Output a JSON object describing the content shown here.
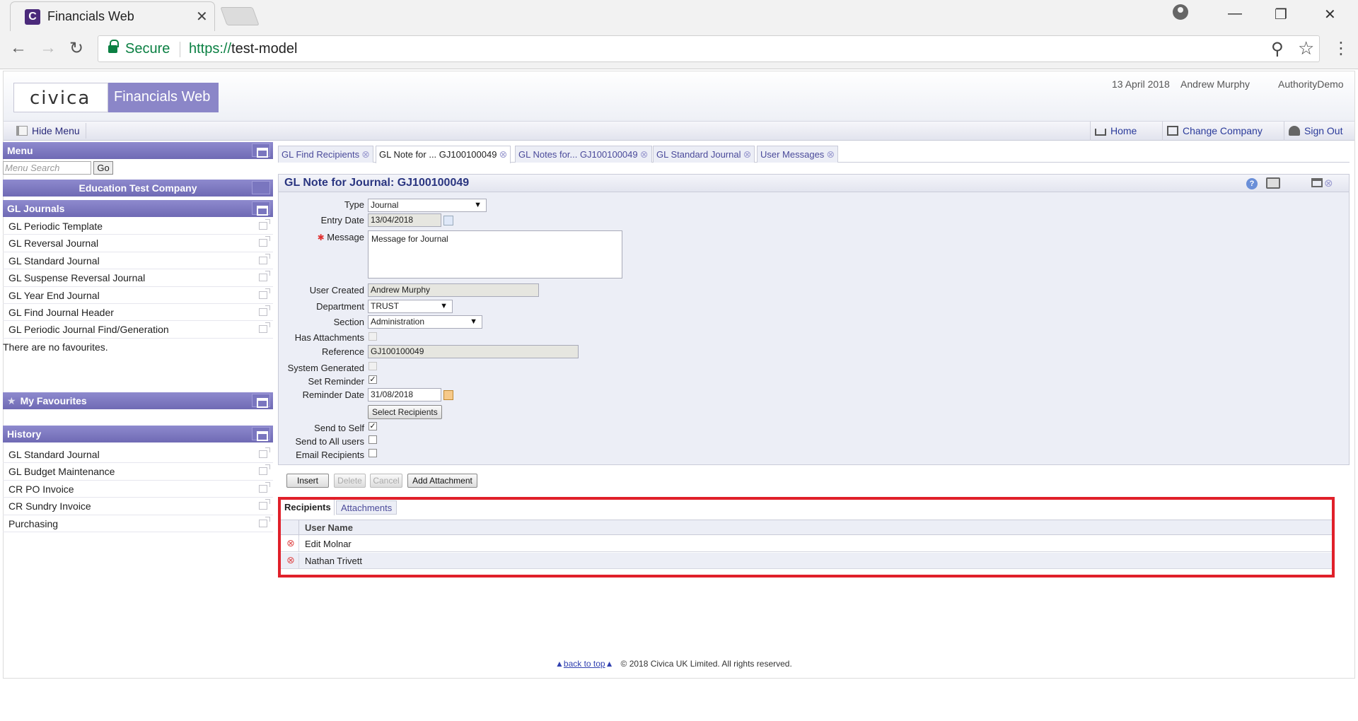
{
  "browser": {
    "tab_title": "Financials Web",
    "secure_label": "Secure",
    "url_scheme": "https://",
    "url_host": "test-model"
  },
  "header": {
    "logo": "civica",
    "product": "Financials Web",
    "date": "13 April 2018",
    "user": "Andrew Murphy",
    "company": "AuthorityDemo"
  },
  "toolbar": {
    "hide_menu": "Hide Menu",
    "home": "Home",
    "change_company": "Change Company",
    "sign_out": "Sign Out"
  },
  "menu": {
    "title": "Menu",
    "search_placeholder": "Menu Search",
    "go": "Go",
    "company": "Education Test Company",
    "section": "GL Journals",
    "items": [
      "GL Periodic Template",
      "GL Reversal Journal",
      "GL Standard Journal",
      "GL Suspense Reversal Journal",
      "GL Year End Journal",
      "GL Find Journal Header",
      "GL Periodic Journal Find/Generation"
    ]
  },
  "favourites": {
    "title": "My Favourites",
    "empty": "There are no favourites."
  },
  "history": {
    "title": "History",
    "items": [
      "GL Standard Journal",
      "GL Budget Maintenance",
      "CR PO Invoice",
      "CR Sundry Invoice",
      "Purchasing"
    ]
  },
  "content_tabs": [
    {
      "label": "GL Find Recipients"
    },
    {
      "label": "GL Note for ... GJ100100049"
    },
    {
      "label": "GL Notes for... GJ100100049"
    },
    {
      "label": "GL Standard Journal"
    },
    {
      "label": "User Messages"
    }
  ],
  "form": {
    "title": "GL Note for Journal: GJ100100049",
    "labels": {
      "type": "Type",
      "entry_date": "Entry Date",
      "message": "Message",
      "user_created": "User Created",
      "department": "Department",
      "section": "Section",
      "has_attachments": "Has Attachments",
      "reference": "Reference",
      "system_generated": "System Generated",
      "set_reminder": "Set Reminder",
      "reminder_date": "Reminder Date",
      "send_to_self": "Send to Self",
      "send_to_all": "Send to All users",
      "email_recipients": "Email Recipients"
    },
    "values": {
      "type": "Journal",
      "entry_date": "13/04/2018",
      "message": "Message for Journal",
      "user_created": "Andrew Murphy",
      "department": "TRUST",
      "section": "Administration",
      "has_attachments": false,
      "reference": "GJ100100049",
      "system_generated": false,
      "set_reminder": true,
      "reminder_date": "31/08/2018",
      "send_to_self": true,
      "send_to_all": false,
      "email_recipients": false
    },
    "select_recipients": "Select Recipients"
  },
  "actions": {
    "insert": "Insert",
    "delete": "Delete",
    "cancel": "Cancel",
    "add_attachment": "Add Attachment"
  },
  "grid": {
    "tabs": {
      "recipients": "Recipients",
      "attachments": "Attachments"
    },
    "column": "User Name",
    "rows": [
      "Edit Molnar",
      "Nathan Trivett"
    ]
  },
  "footer": {
    "back_to_top": "back to top",
    "copyright": "© 2018 Civica UK Limited. All rights reserved."
  },
  "colors": {
    "accent": "#6f6ab4",
    "highlight_border": "#e0202a"
  }
}
